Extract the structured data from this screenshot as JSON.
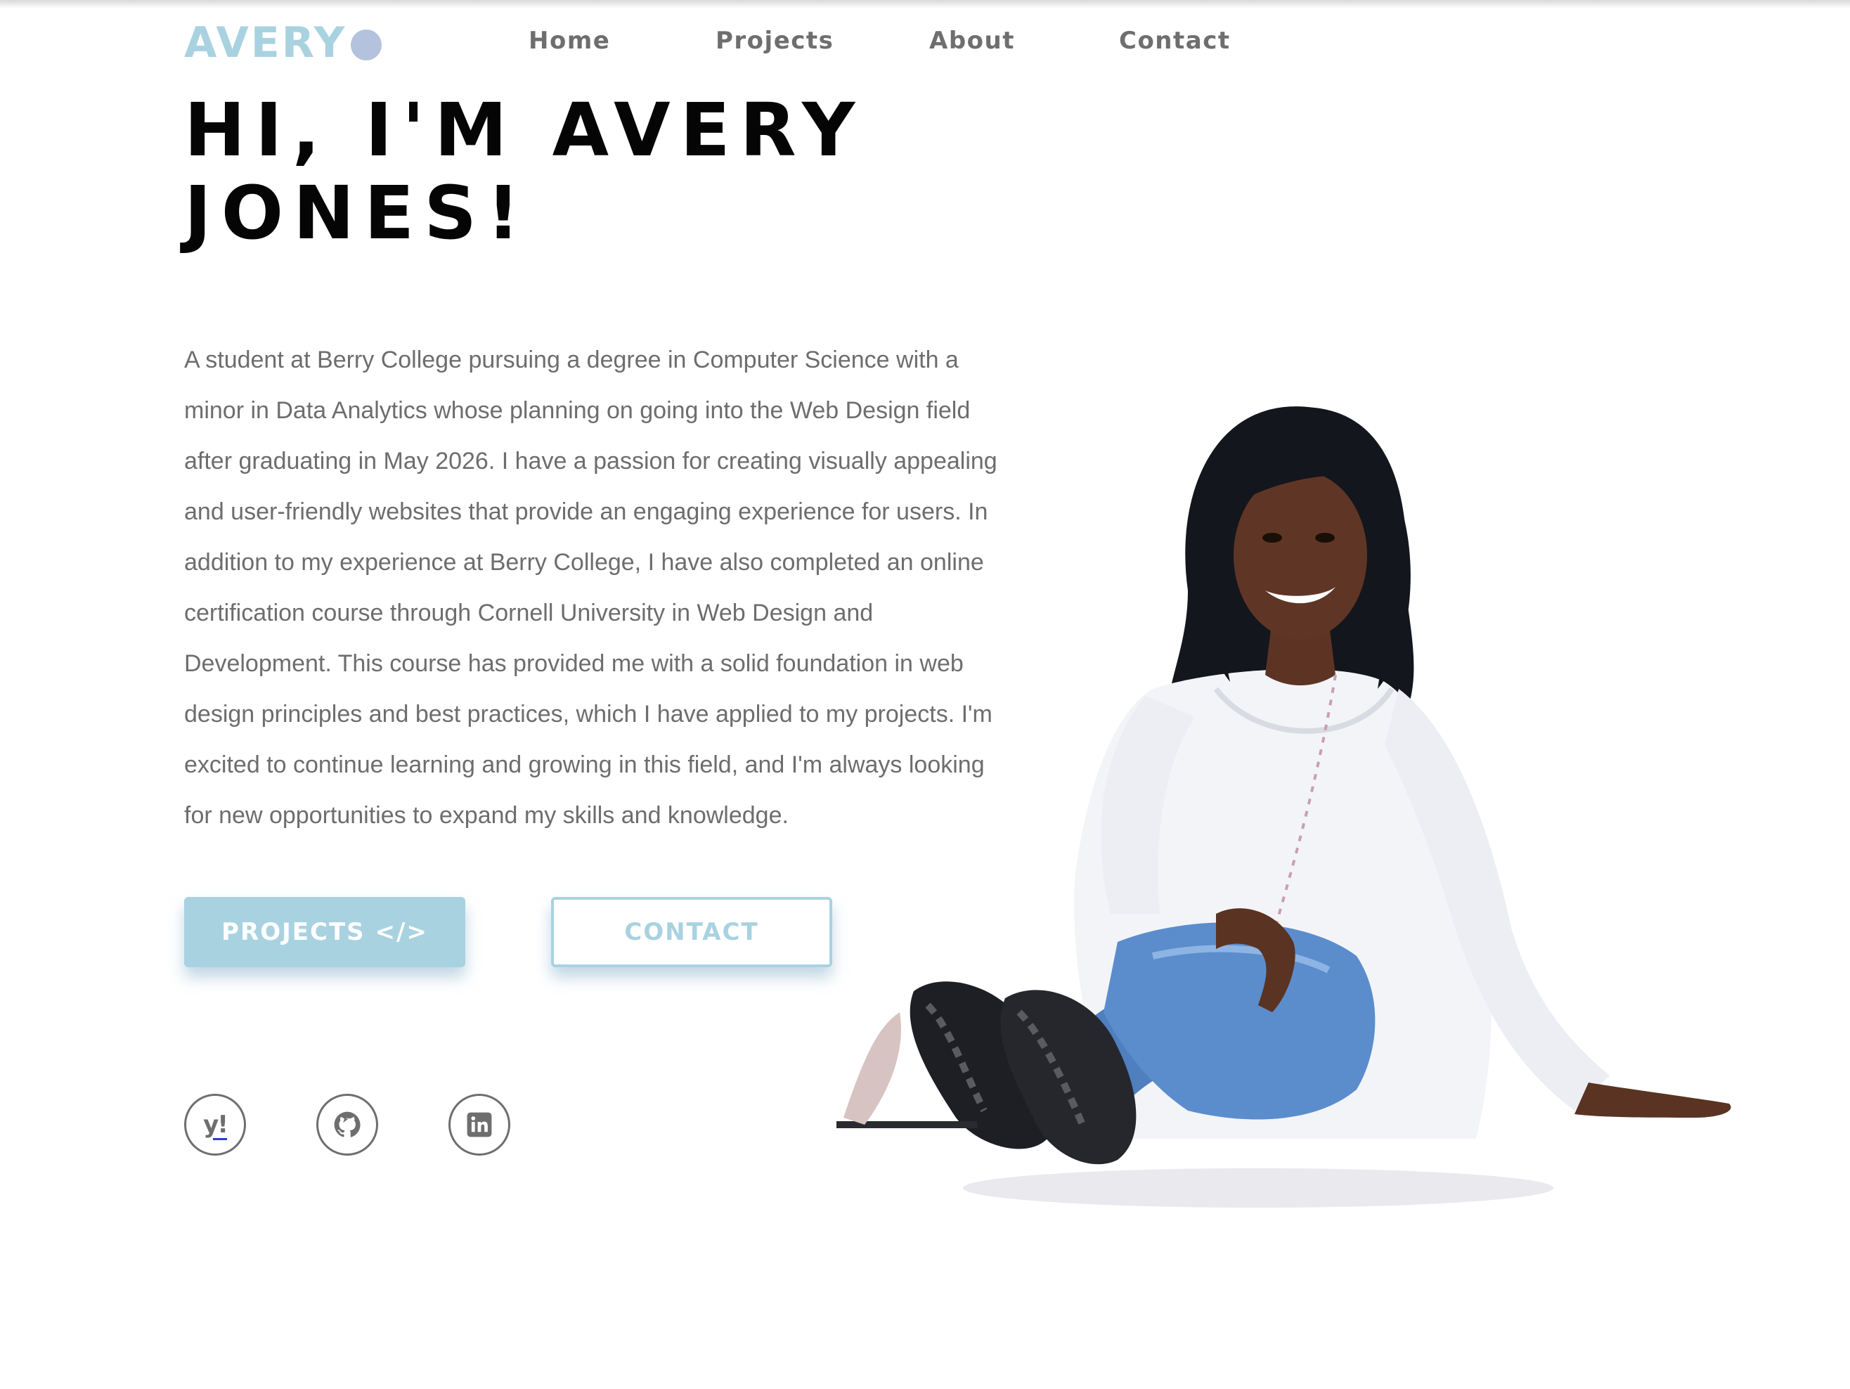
{
  "nav": {
    "logo_text": "AVERY",
    "links": [
      "Home",
      "Projects",
      "About",
      "Contact"
    ]
  },
  "hero": {
    "title_line1": "HI, I'M AVERY",
    "title_line2": "JONES!",
    "bio": "A student at Berry College pursuing a degree in Computer Science with a minor in Data Analytics whose planning on going into the Web Design field after graduating in May 2026. I have a passion for creating visually appealing and user-friendly websites that provide an engaging experience for users. In addition to my experience at Berry College, I have also completed an online certification course through Cornell University in Web Design and Development. This course has provided me with a solid foundation in web design principles and best practices, which I have applied to my projects. I'm excited to continue learning and growing in this field, and I'm always looking for new opportunities to expand my skills and knowledge."
  },
  "buttons": {
    "projects_label": "PROJECTS </>",
    "contact_label": "CONTACT"
  },
  "social": {
    "yahoo_glyph": "y!",
    "icons": [
      "yahoo-icon",
      "github-icon",
      "linkedin-icon"
    ]
  },
  "colors": {
    "accent": "#a9d2e1",
    "logo_dot": "#b5c2de",
    "nav_text": "#6e6e6e",
    "body_text": "#6d6d6d",
    "title": "#050505"
  }
}
